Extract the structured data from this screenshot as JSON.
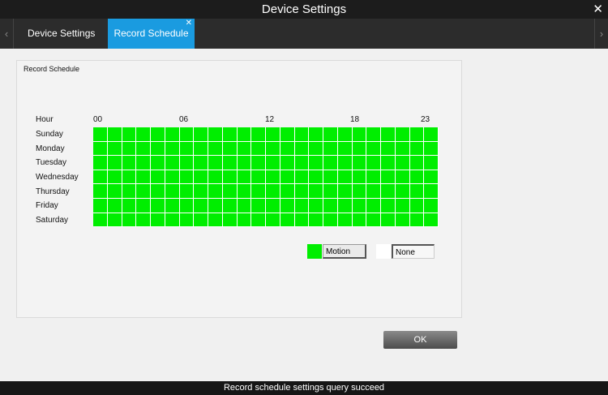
{
  "window": {
    "title": "Device Settings",
    "close_glyph": "✕"
  },
  "tabs": {
    "left_arrow": "‹",
    "right_arrow": "›",
    "items": [
      {
        "label": "Device Settings",
        "active": false
      },
      {
        "label": "Record Schedule",
        "active": true,
        "close_glyph": "✕"
      }
    ]
  },
  "schedule": {
    "section_label": "Record Schedule",
    "hour_label": "Hour",
    "hour_ticks": [
      "00",
      "06",
      "12",
      "18",
      "23"
    ],
    "days": [
      "Sunday",
      "Monday",
      "Tuesday",
      "Wednesday",
      "Thursday",
      "Friday",
      "Saturday"
    ],
    "hours_count": 24,
    "cell_mode": "Motion",
    "colors": {
      "motion": "#00ee00",
      "none": "#ffffff"
    }
  },
  "legend": {
    "motion_label": "Motion",
    "none_label": "None"
  },
  "buttons": {
    "ok_label": "OK"
  },
  "status": {
    "text": "Record schedule settings query succeed"
  }
}
